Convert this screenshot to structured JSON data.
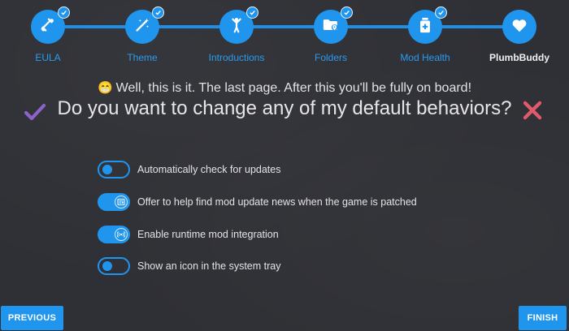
{
  "stepper": {
    "steps": [
      {
        "label": "EULA",
        "icon": "scroll-icon",
        "completed": true
      },
      {
        "label": "Theme",
        "icon": "magic-wand-icon",
        "completed": true
      },
      {
        "label": "Introductions",
        "icon": "person-waving-icon",
        "completed": true
      },
      {
        "label": "Folders",
        "icon": "folder-pin-icon",
        "completed": true
      },
      {
        "label": "Mod Health",
        "icon": "medicine-bottle-icon",
        "completed": true
      },
      {
        "label": "PlumbBuddy",
        "icon": "heart-icon",
        "completed": false,
        "active": true
      }
    ]
  },
  "content": {
    "subtitle": "Well, this is it. The last page. After this you'll be fully on board!",
    "subtitle_emoji": "😁",
    "title": "Do you want to change any of my default behaviors?"
  },
  "options": [
    {
      "label": "Automatically check for updates",
      "enabled": false
    },
    {
      "label": "Offer to help find mod update news when the game is patched",
      "enabled": true,
      "knob_icon": "newspaper-icon"
    },
    {
      "label": "Enable runtime mod integration",
      "enabled": true,
      "knob_icon": "broadcast-icon"
    },
    {
      "label": "Show an icon in the system tray",
      "enabled": false
    }
  ],
  "buttons": {
    "previous": "PREVIOUS",
    "finish": "FINISH"
  },
  "colors": {
    "accent": "#1f95ee",
    "background": "#2f3035",
    "check_mark": "#8e63c9",
    "cross_mark": "#e05a6b"
  }
}
